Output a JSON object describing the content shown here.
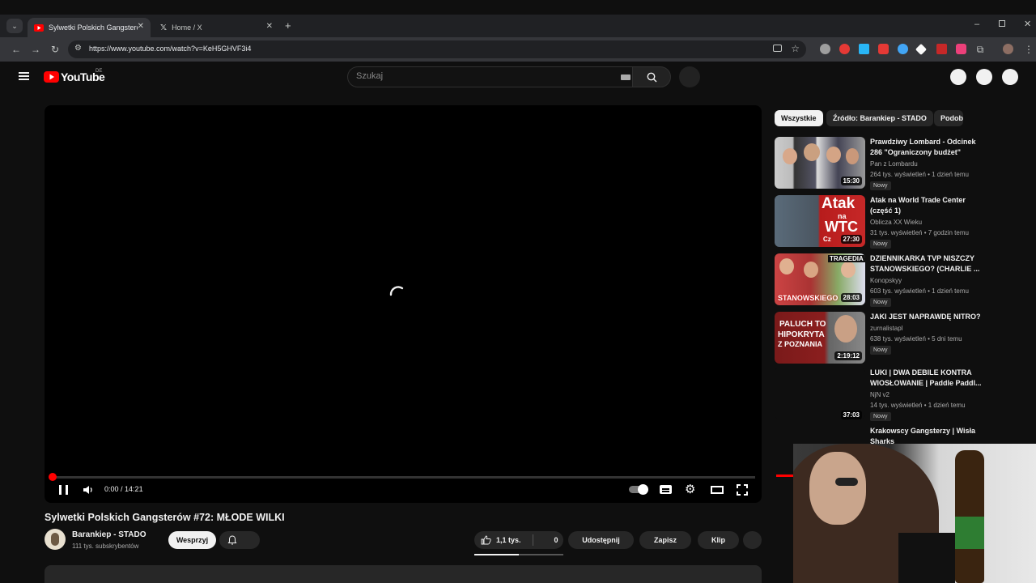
{
  "browser": {
    "tabs": [
      {
        "title": "Sylwetki Polskich Gangsterów #",
        "active": true
      },
      {
        "title": "Home / X",
        "active": false
      }
    ],
    "url": "https://www.youtube.com/watch?v=KeH5GHVF3i4"
  },
  "youtube": {
    "logo_text": "YouTube",
    "region": "DE",
    "search_placeholder": "Szukaj",
    "player": {
      "current_time": "0:00",
      "separator": " / ",
      "duration": "14:21",
      "progress": 0.001
    },
    "video": {
      "title": "Sylwetki Polskich Gangsterów #72: MŁODE WILKI",
      "channel": "Barankiep - STADO",
      "subscribers": "111 tys. subskrybentów",
      "support_label": "Wesprzyj",
      "likes": "1,1 tys.",
      "dislikes": "0",
      "share_label": "Udostępnij",
      "save_label": "Zapisz",
      "clip_label": "Klip"
    },
    "chips": [
      "Wszystkie",
      "Źródło: Barankiep - STADO",
      "Podob"
    ],
    "recommendations": [
      {
        "title": "Prawdziwy Lombard - Odcinek 286 \"Ograniczony budżet\"",
        "channel": "Pan z Lombardu",
        "meta": "264 tys. wyświetleń • 1 dzień temu",
        "badge": "Nowy",
        "duration": "15:30"
      },
      {
        "title": "Atak na World Trade Center (część 1)",
        "channel": "Oblicza XX Wieku",
        "meta": "31 tys. wyświetleń • 7 godzin temu",
        "badge": "Nowy",
        "duration": "27:30",
        "thumb_text1": "Atak",
        "thumb_text2": "na",
        "thumb_text3": "WTC",
        "thumb_text4": "Cz"
      },
      {
        "title": "DZIENNIKARKA TVP NISZCZY STANOWSKIEGO? (CHARLIE ...",
        "channel": "Konopskyy",
        "meta": "603 tys. wyświetleń • 1 dzień temu",
        "badge": "Nowy",
        "duration": "28:03",
        "thumb_text1": "TRAGEDIA",
        "thumb_text2": "STANOWSKIEGO"
      },
      {
        "title": "JAKI JEST NAPRAWDĘ NITRO?",
        "channel": "zurnalistapl",
        "meta": "638 tys. wyświetleń • 5 dni temu",
        "badge": "Nowy",
        "duration": "2:19:12",
        "thumb_text1": "PALUCH TO",
        "thumb_text2": "HIPOKRYTA",
        "thumb_text3": "Z POZNANIA"
      },
      {
        "title": "LUKI | DWA DEBILE KONTRA WIOSŁOWANIE | Paddle Paddl...",
        "channel": "NjN v2",
        "meta": "14 tys. wyświetleń • 1 dzień temu",
        "badge": "Nowy",
        "duration": "37:03"
      },
      {
        "title": "Krakowscy Gangsterzy | Wisła Sharks",
        "channel": "",
        "meta": "",
        "badge": "",
        "duration": ""
      }
    ],
    "colors": {
      "accent": "#ff0000",
      "bg": "#0f0f0f",
      "surface": "#272727"
    }
  }
}
